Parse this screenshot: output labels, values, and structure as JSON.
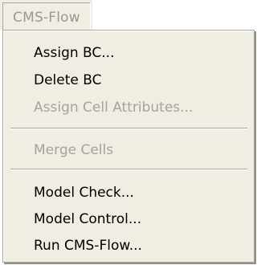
{
  "menubar": {
    "label": "CMS-Flow"
  },
  "menu": {
    "items": [
      {
        "label": "Assign BC...",
        "enabled": true
      },
      {
        "label": "Delete BC",
        "enabled": true
      },
      {
        "label": "Assign Cell Attributes...",
        "enabled": false
      },
      {
        "label": "Merge Cells",
        "enabled": false
      },
      {
        "label": "Model Check...",
        "enabled": true
      },
      {
        "label": "Model Control...",
        "enabled": true
      },
      {
        "label": "Run CMS-Flow...",
        "enabled": true
      }
    ]
  },
  "colors": {
    "menu_background": "#f0ede2",
    "disabled_text": "#a5a39b",
    "enabled_text": "#000000"
  }
}
